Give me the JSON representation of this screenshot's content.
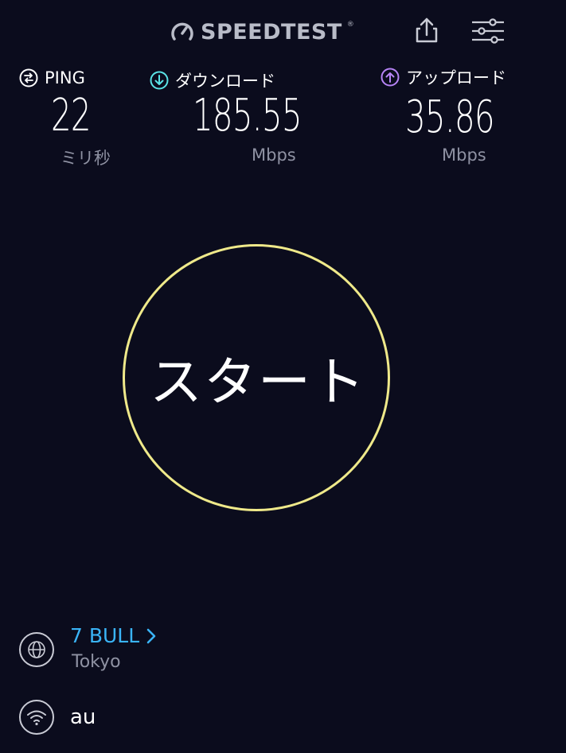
{
  "header": {
    "logo_text": "SPEEDTEST",
    "logo_tm": "®",
    "share_icon": "share-icon",
    "settings_icon": "settings-sliders-icon"
  },
  "metrics": {
    "ping": {
      "label": "PING",
      "value": "22",
      "unit": "ミリ秒",
      "icon": "ping-icon",
      "color": "#ffffff"
    },
    "download": {
      "label": "ダウンロード",
      "value": "185.55",
      "unit": "Mbps",
      "icon": "download-arrow-icon",
      "color": "#5ae3e6"
    },
    "upload": {
      "label": "アップロード",
      "value": "35.86",
      "unit": "Mbps",
      "icon": "upload-arrow-icon",
      "color": "#b784f6"
    }
  },
  "start_button": {
    "label": "スタート",
    "ring_color": "#efe98a"
  },
  "server": {
    "name": "7 BULL",
    "location": "Tokyo",
    "icon": "globe-icon",
    "link_color": "#3ab4f7"
  },
  "connection": {
    "carrier": "au",
    "icon": "wifi-icon"
  }
}
